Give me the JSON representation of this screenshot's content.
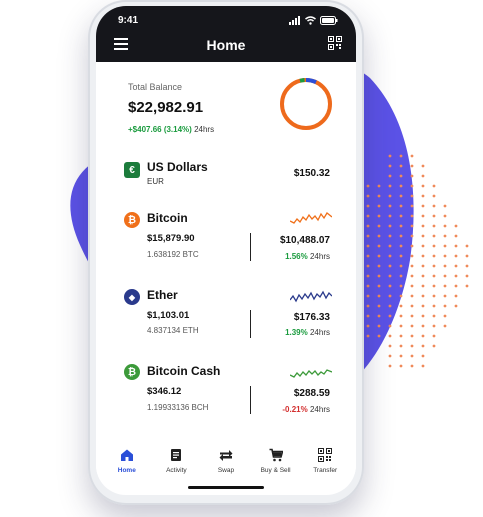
{
  "status": {
    "time": "9:41"
  },
  "header": {
    "title": "Home"
  },
  "balance": {
    "label": "Total Balance",
    "value": "$22,982.91",
    "change": "+$407.66 (3.14%)",
    "period": "24hrs"
  },
  "assets": [
    {
      "name": "US Dollars",
      "sub": "EUR",
      "fiat": "$150.32",
      "icon": "euro-icon",
      "icon_glyph": "€",
      "color": "#1c7c3c"
    },
    {
      "name": "Bitcoin",
      "value": "$15,879.90",
      "qty": "1.638192 BTC",
      "fiat": "$10,488.07",
      "change": "1.56%",
      "period": "24hrs",
      "direction": "up",
      "icon": "bitcoin-icon",
      "icon_glyph": "₿",
      "color": "#f0701a",
      "spark_color": "#f0701a"
    },
    {
      "name": "Ether",
      "value": "$1,103.01",
      "qty": "4.837134 ETH",
      "fiat": "$176.33",
      "change": "1.39%",
      "period": "24hrs",
      "direction": "up",
      "icon": "ether-icon",
      "icon_glyph": "◆",
      "color": "#2a3a8c",
      "spark_color": "#2a3a8c"
    },
    {
      "name": "Bitcoin Cash",
      "value": "$346.12",
      "qty": "1.19933136 BCH",
      "fiat": "$288.59",
      "change": "-0.21%",
      "period": "24hrs",
      "direction": "down",
      "icon": "bitcoin-cash-icon",
      "icon_glyph": "₿",
      "color": "#3c9a3a",
      "spark_color": "#3c9a3a"
    }
  ],
  "nav": [
    {
      "label": "Home",
      "icon": "home-icon",
      "active": true
    },
    {
      "label": "Activity",
      "icon": "activity-icon"
    },
    {
      "label": "Swap",
      "icon": "swap-icon"
    },
    {
      "label": "Buy & Sell",
      "icon": "cart-icon"
    },
    {
      "label": "Transfer",
      "icon": "qr-icon"
    }
  ],
  "colors": {
    "accent": "#2b4fd8",
    "up": "#1a9b3e",
    "down": "#d32f2f",
    "header_bg": "#15161b",
    "blob": "#5b52e6",
    "dots": "#f08a5a"
  }
}
